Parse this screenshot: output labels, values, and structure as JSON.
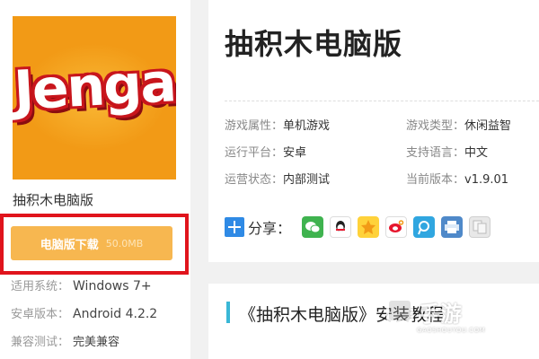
{
  "app": {
    "logo_text": "Jenga",
    "name": "抽积木电脑版",
    "download_label": "电脑版下载",
    "download_size": "50.0MB"
  },
  "sidebar_info": [
    {
      "label": "适用系统：",
      "value": "Windows 7+"
    },
    {
      "label": "安卓版本：",
      "value": "Android 4.2.2"
    },
    {
      "label": "兼容测试：",
      "value": "完美兼容"
    }
  ],
  "detail": {
    "title": "抽积木电脑版",
    "attrs": [
      {
        "label": "游戏属性：",
        "value": "单机游戏"
      },
      {
        "label": "游戏类型：",
        "value": "休闲益智"
      },
      {
        "label": "运行平台：",
        "value": "安卓"
      },
      {
        "label": "支持语言：",
        "value": "中文"
      },
      {
        "label": "运营状态：",
        "value": "内部测试"
      },
      {
        "label": "当前版本：",
        "value": "v1.9.01"
      }
    ],
    "share_label": "分享："
  },
  "section": {
    "title": "《抽积木电脑版》安装教程"
  },
  "watermark": {
    "text": "手游",
    "url": "GAOSHOUYOU.COM"
  },
  "colors": {
    "accent_orange": "#f7b750",
    "highlight_red": "#e0141c",
    "section_bar": "#39b7d6"
  }
}
